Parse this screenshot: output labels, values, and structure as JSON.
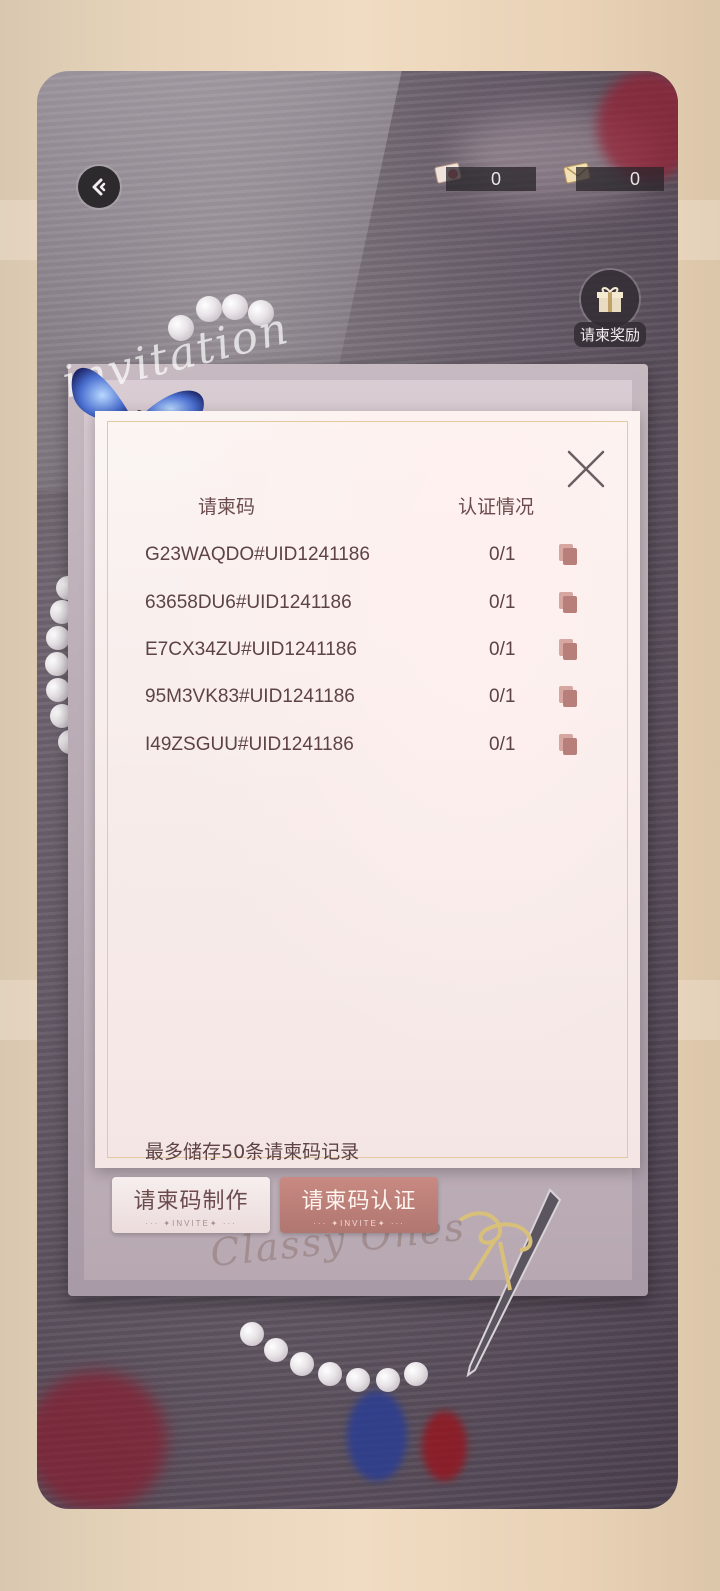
{
  "topbar": {
    "back_icon": "back-arrow-icon",
    "currency": [
      {
        "icon": "letter-envelope-icon",
        "value": "0"
      },
      {
        "icon": "gold-envelope-icon",
        "value": "0"
      }
    ]
  },
  "reward": {
    "icon": "gift-box-icon",
    "label": "请柬奖励"
  },
  "dialog": {
    "columns": {
      "code": "请柬码",
      "status": "认证情况"
    },
    "rows": [
      {
        "code": "G23WAQDO#UID1241186",
        "count": "0/1"
      },
      {
        "code": "63658DU6#UID1241186",
        "count": "0/1"
      },
      {
        "code": "E7CX34ZU#UID1241186",
        "count": "0/1"
      },
      {
        "code": "95M3VK83#UID1241186",
        "count": "0/1"
      },
      {
        "code": "I49ZSGUU#UID1241186",
        "count": "0/1"
      }
    ],
    "note": "最多储存50条请柬码记录",
    "close_icon": "close-x-icon",
    "copy_icon": "copy-icon"
  },
  "actions": {
    "make": {
      "label": "请柬码制作",
      "sub": "··· ✦INVITE✦ ···"
    },
    "verify": {
      "label": "请柬码认证",
      "sub": "··· ✦INVITE✦ ···"
    }
  },
  "colors": {
    "accent": "#b07670",
    "text": "#5e4346",
    "frame": "#e2c9a0"
  }
}
